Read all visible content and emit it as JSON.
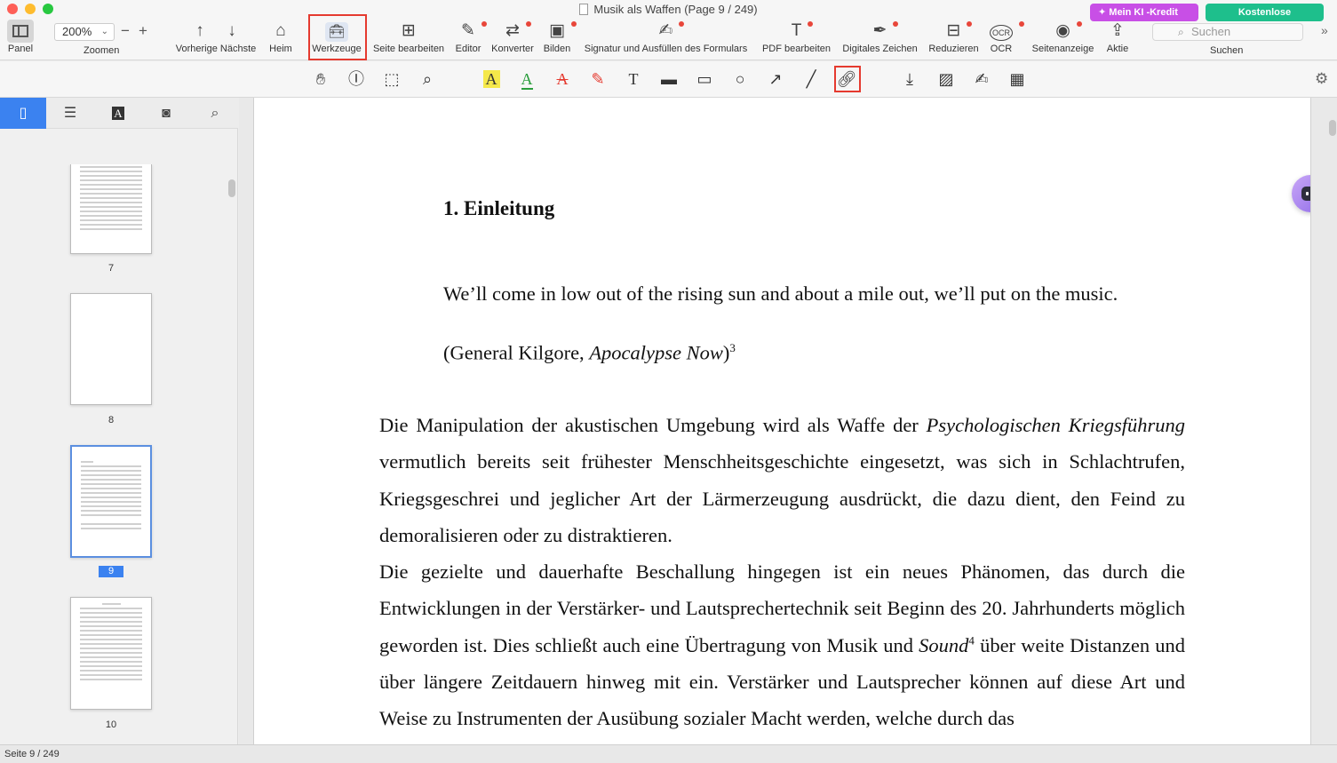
{
  "window": {
    "title": "Musik als Waffen (Page 9 / 249)"
  },
  "promos": {
    "ai_credit": "Mein KI -Kredit",
    "trial": "Kostenlose Testphase"
  },
  "toolbar": {
    "panel": "Panel",
    "zoom_value": "200%",
    "zoom_label": "Zoomen",
    "prev_next": "Vorherige Nächste",
    "home": "Heim",
    "tools": "Werkzeuge",
    "edit_page": "Seite bearbeiten",
    "editor": "Editor",
    "converter": "Konverter",
    "image": "Bilden",
    "sign_fill": "Signatur und Ausfüllen des Formulars",
    "edit_pdf": "PDF bearbeiten",
    "digital_sign": "Digitales Zeichen",
    "reduce": "Reduzieren",
    "ocr": "OCR",
    "page_view": "Seitenanzeige",
    "share": "Aktie",
    "search_placeholder": "Suchen",
    "search_label": "Suchen"
  },
  "icons": {
    "accent_blue": "#3b82f0",
    "highlight_red": "#e53a2f",
    "ai_purple": "#c84fe6",
    "trial_green": "#1ebf8c"
  },
  "sidebar": {
    "pages": [
      {
        "num": "7"
      },
      {
        "num": "8"
      },
      {
        "num": "9"
      },
      {
        "num": "10"
      }
    ]
  },
  "document": {
    "heading": "1. Einleitung",
    "quote": "We’ll come in low out of the rising sun and about a mile out, we’ll put on the music.",
    "quote_source_prefix": "(General Kilgore, ",
    "quote_source_title": "Apocalypse Now",
    "quote_source_suffix": ")",
    "quote_footnote": "3",
    "p1_italic_a": "Psychologischen",
    "p1_italic_b": "Kriegsführung",
    "p1_start": "Die Manipulation der akustischen Umgebung wird als Waffe der ",
    "p1_rest": " vermutlich bereits seit frühester Menschheitsgeschichte eingesetzt, was sich in Schlachtrufen, Kriegsgeschrei und jeglicher Art der Lärmerzeugung ausdrückt, die dazu dient, den Feind zu demoralisieren oder zu distraktieren.",
    "p2_start": "Die gezielte und dauerhafte Beschallung hingegen ist ein neues Phänomen, das durch die Entwicklungen in der Verstärker- und Lautsprechertechnik seit Beginn des 20. Jahrhunderts möglich geworden ist. Dies schließt auch eine Übertragung von Musik und ",
    "p2_italic": "Sound",
    "p2_footnote": "4",
    "p2_rest": " über weite Distanzen und über längere Zeitdauern hinweg mit ein. Verstärker und Lautsprecher können auf diese Art und Weise zu Instrumenten der Ausübung sozialer Macht werden, welche durch das"
  },
  "status": {
    "page_info": "Seite 9 / 249"
  }
}
